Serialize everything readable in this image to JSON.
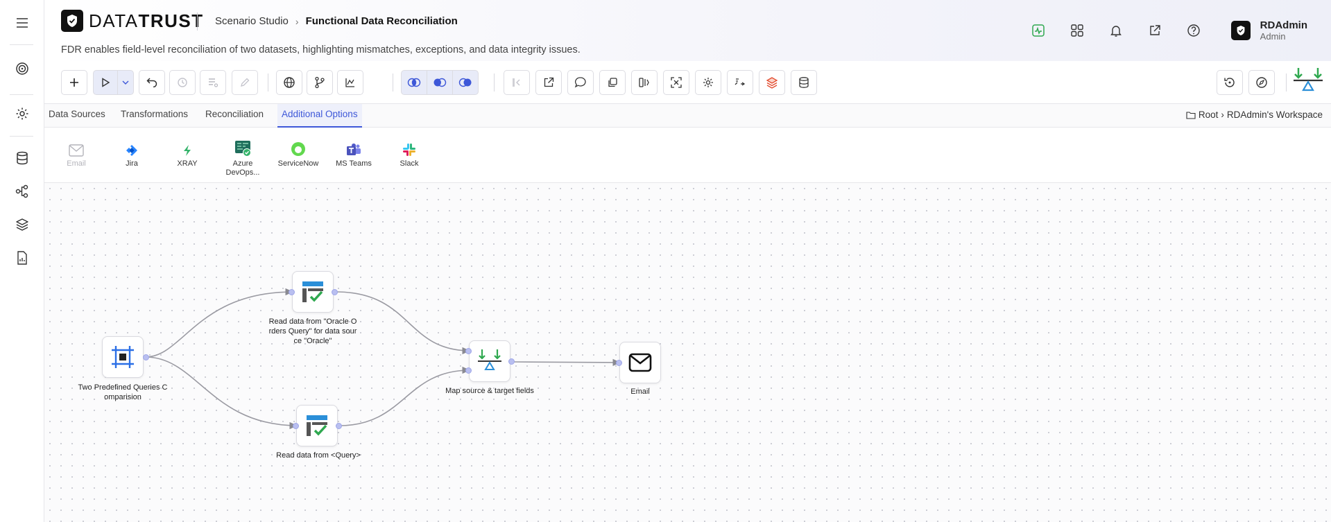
{
  "brand": {
    "name_light": "DATA",
    "name_bold": "TRUST"
  },
  "breadcrumb": {
    "parent": "Scenario Studio",
    "current": "Functional Data Reconciliation"
  },
  "description": "FDR enables field-level reconciliation of two datasets, highlighting mismatches, exceptions, and data integrity issues.",
  "user": {
    "name": "RDAdmin",
    "role": "Admin"
  },
  "tabs": [
    {
      "label": "Data Sources"
    },
    {
      "label": "Transformations"
    },
    {
      "label": "Reconciliation"
    },
    {
      "label": "Additional Options"
    }
  ],
  "workspace_path": {
    "root": "Root",
    "workspace": "RDAdmin's Workspace"
  },
  "palette": [
    {
      "label": "Email",
      "icon": "mail-icon"
    },
    {
      "label": "Jira",
      "icon": "jira-icon"
    },
    {
      "label": "XRAY",
      "icon": "xray-icon"
    },
    {
      "label": "Azure DevOps...",
      "icon": "azure-devops-icon"
    },
    {
      "label": "ServiceNow",
      "icon": "servicenow-icon"
    },
    {
      "label": "MS Teams",
      "icon": "ms-teams-icon"
    },
    {
      "label": "Slack",
      "icon": "slack-icon"
    }
  ],
  "nodes": {
    "source": {
      "label": "Two Predefined Queries Comparision"
    },
    "oracle": {
      "label": "Read data from \"Oracle Orders Query\" for data source \"Oracle\""
    },
    "query": {
      "label": "Read data from <Query>"
    },
    "map": {
      "label": "Map source & target fields"
    },
    "email": {
      "label": "Email"
    }
  },
  "colors": {
    "accent": "#3d57d8",
    "brand": "#111111",
    "success": "#2fa84f"
  }
}
